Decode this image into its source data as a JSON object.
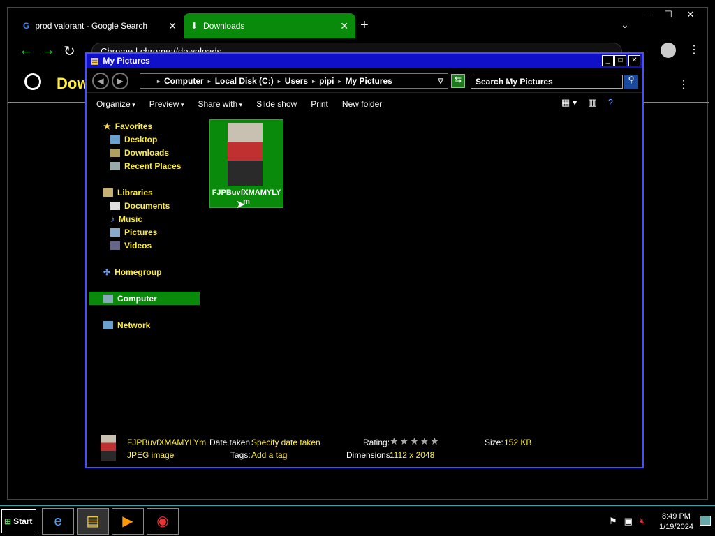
{
  "browser": {
    "tabs": [
      {
        "label": "prod valorant - Google Search"
      },
      {
        "label": "Downloads"
      }
    ],
    "omnibox": "Chrome  |  chrome://downloads",
    "page_title": "Downloads"
  },
  "explorer": {
    "title": "My Pictures",
    "address": [
      "Computer",
      "Local Disk (C:)",
      "Users",
      "pipi",
      "My Pictures"
    ],
    "search_placeholder": "Search My Pictures",
    "commands": [
      "Organize",
      "Preview",
      "Share with",
      "Slide show",
      "Print",
      "New folder"
    ],
    "nav": {
      "favorites": {
        "label": "Favorites",
        "items": [
          "Desktop",
          "Downloads",
          "Recent Places"
        ]
      },
      "libraries": {
        "label": "Libraries",
        "items": [
          "Documents",
          "Music",
          "Pictures",
          "Videos"
        ]
      },
      "homegroup": "Homegroup",
      "computer": "Computer",
      "network": "Network"
    },
    "file": {
      "name": "FJPBuvfXMAMYLYm"
    },
    "details": {
      "name": "FJPBuvfXMAMYLYm",
      "type": "JPEG image",
      "date_label": "Date taken:",
      "date_value": "Specify date taken",
      "tags_label": "Tags:",
      "tags_value": "Add a tag",
      "rating_label": "Rating:",
      "rating_stars": "★★★★★",
      "dimensions_label": "Dimensions:",
      "dimensions_value": "1112 x 2048",
      "size_label": "Size:",
      "size_value": "152 KB"
    }
  },
  "taskbar": {
    "start": "Start",
    "time": "8:49 PM",
    "date": "1/19/2024"
  }
}
